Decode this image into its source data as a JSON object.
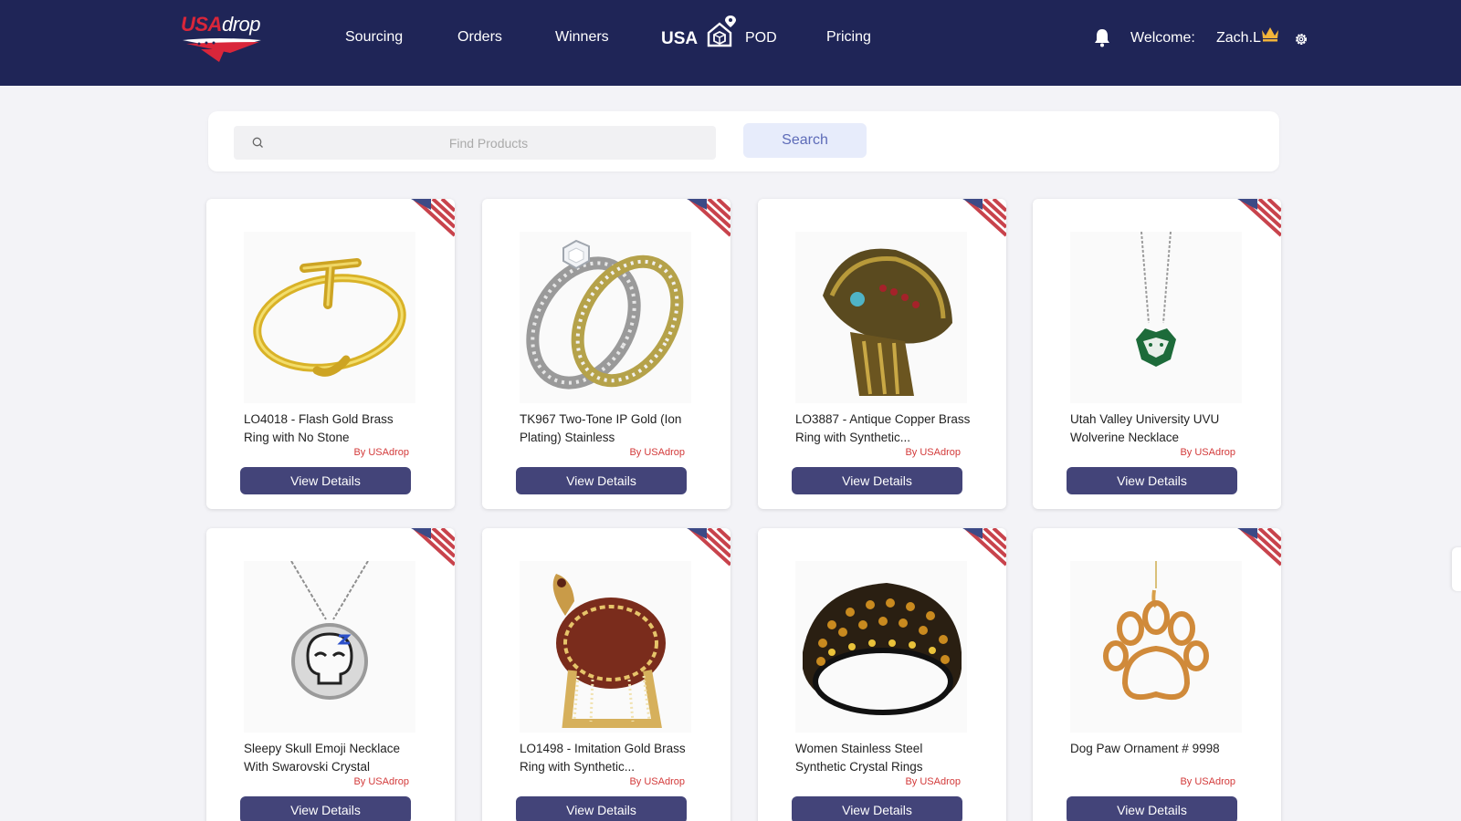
{
  "brand": {
    "logo_usa": "USA",
    "logo_drop": "drop"
  },
  "nav": {
    "sourcing": "Sourcing",
    "orders": "Orders",
    "winners": "Winners",
    "usa": "USA",
    "pod": "POD",
    "pricing": "Pricing"
  },
  "user": {
    "welcome": "Welcome:",
    "name": "Zach.L"
  },
  "search": {
    "placeholder": "Find Products",
    "button": "Search"
  },
  "products": [
    {
      "title": "LO4018 - Flash Gold Brass Ring with No Stone",
      "by": "By USAdrop",
      "button": "View Details"
    },
    {
      "title": "TK967 Two-Tone IP Gold (Ion Plating) Stainless",
      "by": "By USAdrop",
      "button": "View Details"
    },
    {
      "title": "LO3887 - Antique Copper Brass Ring with Synthetic...",
      "by": "By USAdrop",
      "button": "View Details"
    },
    {
      "title": "Utah Valley University UVU Wolverine Necklace",
      "by": "By USAdrop",
      "button": "View Details"
    },
    {
      "title": "Sleepy Skull Emoji Necklace With Swarovski Crystal",
      "by": "By USAdrop",
      "button": "View Details"
    },
    {
      "title": "LO1498 - Imitation Gold Brass Ring with Synthetic...",
      "by": "By USAdrop",
      "button": "View Details"
    },
    {
      "title": "Women Stainless Steel Synthetic Crystal Rings",
      "by": "By USAdrop",
      "button": "View Details"
    },
    {
      "title": "Dog Paw Ornament # 9998",
      "by": "By USAdrop",
      "button": "View Details"
    }
  ],
  "colors": {
    "header_bg": "#1f2557",
    "button_bg": "#434479",
    "accent_red": "#d33a3a",
    "search_button_bg": "#e7ecfb"
  },
  "icons": [
    "search-icon",
    "bell-icon",
    "crown-icon",
    "gear-icon",
    "house-location-icon",
    "us-flag-icon"
  ]
}
